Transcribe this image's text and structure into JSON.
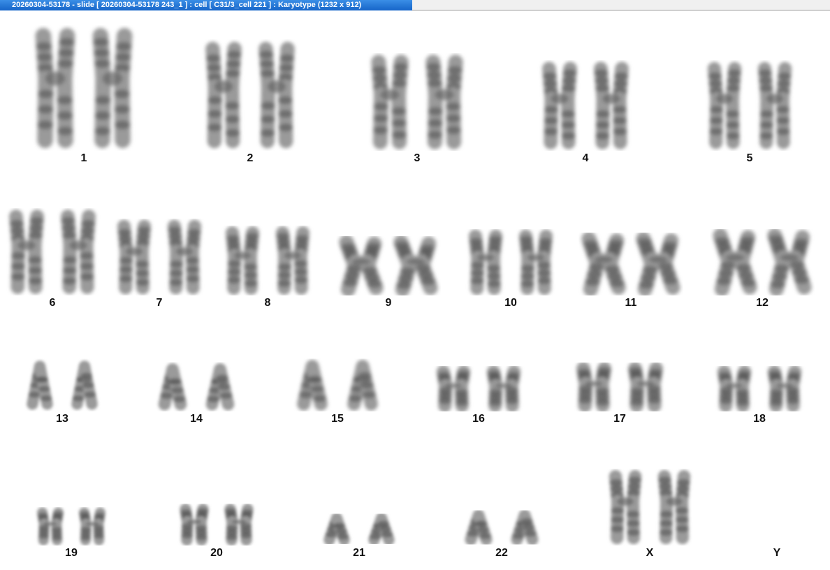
{
  "window": {
    "title": "20260304-53178 - slide [ 20260304-53178 243_1 ] : cell [ C31/3_cell 221 ] : Karyotype  (1232 x 912)"
  },
  "karyotype": {
    "chromosomes": [
      {
        "label": "1",
        "count": 2
      },
      {
        "label": "2",
        "count": 2
      },
      {
        "label": "3",
        "count": 2
      },
      {
        "label": "4",
        "count": 2
      },
      {
        "label": "5",
        "count": 2
      },
      {
        "label": "6",
        "count": 2
      },
      {
        "label": "7",
        "count": 2
      },
      {
        "label": "8",
        "count": 2
      },
      {
        "label": "9",
        "count": 2
      },
      {
        "label": "10",
        "count": 2
      },
      {
        "label": "11",
        "count": 2
      },
      {
        "label": "12",
        "count": 2
      },
      {
        "label": "13",
        "count": 2
      },
      {
        "label": "14",
        "count": 2
      },
      {
        "label": "15",
        "count": 2
      },
      {
        "label": "16",
        "count": 2
      },
      {
        "label": "17",
        "count": 2
      },
      {
        "label": "18",
        "count": 2
      },
      {
        "label": "19",
        "count": 2
      },
      {
        "label": "20",
        "count": 2
      },
      {
        "label": "21",
        "count": 2
      },
      {
        "label": "22",
        "count": 2
      },
      {
        "label": "X",
        "count": 2
      },
      {
        "label": "Y",
        "count": 0
      }
    ]
  }
}
